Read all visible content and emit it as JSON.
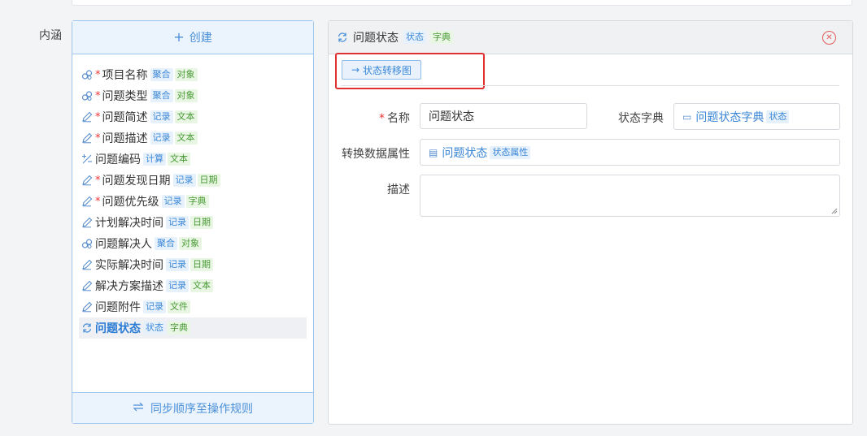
{
  "section_label": "内涵",
  "left_panel": {
    "create_label": "创建",
    "items": [
      {
        "icon": "link-icon",
        "required": true,
        "name": "项目名称",
        "tags": [
          {
            "text": "聚合",
            "color": "blue"
          },
          {
            "text": "对象",
            "color": "green"
          }
        ]
      },
      {
        "icon": "link-icon",
        "required": true,
        "name": "问题类型",
        "tags": [
          {
            "text": "聚合",
            "color": "blue"
          },
          {
            "text": "对象",
            "color": "green"
          }
        ]
      },
      {
        "icon": "pencil-icon",
        "required": true,
        "name": "问题简述",
        "tags": [
          {
            "text": "记录",
            "color": "blue"
          },
          {
            "text": "文本",
            "color": "green"
          }
        ]
      },
      {
        "icon": "pencil-icon",
        "required": true,
        "name": "问题描述",
        "tags": [
          {
            "text": "记录",
            "color": "blue"
          },
          {
            "text": "文本",
            "color": "green"
          }
        ]
      },
      {
        "icon": "calculate-icon",
        "required": false,
        "name": "问题编码",
        "tags": [
          {
            "text": "计算",
            "color": "blue"
          },
          {
            "text": "文本",
            "color": "green"
          }
        ]
      },
      {
        "icon": "pencil-icon",
        "required": true,
        "name": "问题发现日期",
        "tags": [
          {
            "text": "记录",
            "color": "blue"
          },
          {
            "text": "日期",
            "color": "green"
          }
        ]
      },
      {
        "icon": "pencil-icon",
        "required": true,
        "name": "问题优先级",
        "tags": [
          {
            "text": "记录",
            "color": "blue"
          },
          {
            "text": "字典",
            "color": "green"
          }
        ]
      },
      {
        "icon": "pencil-icon",
        "required": false,
        "name": "计划解决时间",
        "tags": [
          {
            "text": "记录",
            "color": "blue"
          },
          {
            "text": "日期",
            "color": "green"
          }
        ]
      },
      {
        "icon": "link-icon",
        "required": false,
        "name": "问题解决人",
        "tags": [
          {
            "text": "聚合",
            "color": "blue"
          },
          {
            "text": "对象",
            "color": "green"
          }
        ]
      },
      {
        "icon": "pencil-icon",
        "required": false,
        "name": "实际解决时间",
        "tags": [
          {
            "text": "记录",
            "color": "blue"
          },
          {
            "text": "日期",
            "color": "green"
          }
        ]
      },
      {
        "icon": "pencil-icon",
        "required": false,
        "name": "解决方案描述",
        "tags": [
          {
            "text": "记录",
            "color": "blue"
          },
          {
            "text": "文本",
            "color": "green"
          }
        ]
      },
      {
        "icon": "pencil-icon",
        "required": false,
        "name": "问题附件",
        "tags": [
          {
            "text": "记录",
            "color": "blue"
          },
          {
            "text": "文件",
            "color": "green"
          }
        ]
      },
      {
        "icon": "refresh-icon",
        "required": false,
        "name": "问题状态",
        "selected": true,
        "tags": [
          {
            "text": "状态",
            "color": "blue"
          },
          {
            "text": "字典",
            "color": "green"
          }
        ]
      }
    ],
    "sync_label": "同步顺序至操作规则"
  },
  "right_panel": {
    "header": {
      "title": "问题状态",
      "tag1": "状态",
      "tag2": "字典"
    },
    "transition_button_label": "状态转移图",
    "form": {
      "name_label": "名称",
      "name_value": "问题状态",
      "dict_label": "状态字典",
      "dict_value": "问题状态字典",
      "dict_tag": "状态",
      "convert_label": "转换数据属性",
      "convert_value": "问题状态",
      "convert_tag": "状态属性",
      "desc_label": "描述",
      "desc_value": ""
    }
  },
  "colors": {
    "accent": "#4a90d9",
    "required": "#e33333",
    "highlight": "#e03030",
    "tag_blue_bg": "#e6f1fc",
    "tag_green_bg": "#e8f6e3"
  }
}
